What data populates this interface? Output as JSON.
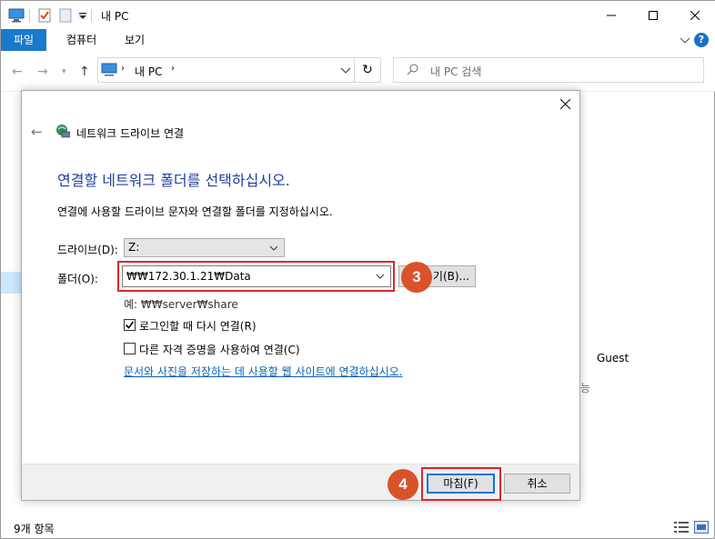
{
  "window": {
    "title": "내 PC",
    "ribbon_tabs": [
      "파일",
      "컴퓨터",
      "보기"
    ],
    "address_path": "내 PC",
    "search_placeholder": "내 PC 검색",
    "status_text": "9개 항목",
    "bg_user": "Guest",
    "bg_partial": "능"
  },
  "dialog": {
    "title": "네트워크 드라이브 연결",
    "heading": "연결할 네트워크 폴더를 선택하십시오.",
    "description": "연결에 사용할 드라이브 문자와 연결할 폴더를 지정하십시오.",
    "drive_label": "드라이브(D):",
    "drive_value": "Z:",
    "folder_label": "폴더(O):",
    "folder_value": "₩₩172.30.1.21₩Data",
    "browse_label": "기(B)...",
    "example_text": "예: ₩₩server₩share",
    "reconnect_label": "로그인할 때 다시 연결(R)",
    "reconnect_checked": true,
    "credentials_label": "다른 자격 증명을 사용하여 연결(C)",
    "credentials_checked": false,
    "link_text": "문서와 사진을 저장하는 데 사용할 웹 사이트에 연결하십시오.",
    "finish_label": "마침(F)",
    "cancel_label": "취소"
  },
  "annotations": {
    "step3": "3",
    "step4": "4",
    "highlight_color": "#e0262b",
    "badge_color": "#d9532a"
  }
}
